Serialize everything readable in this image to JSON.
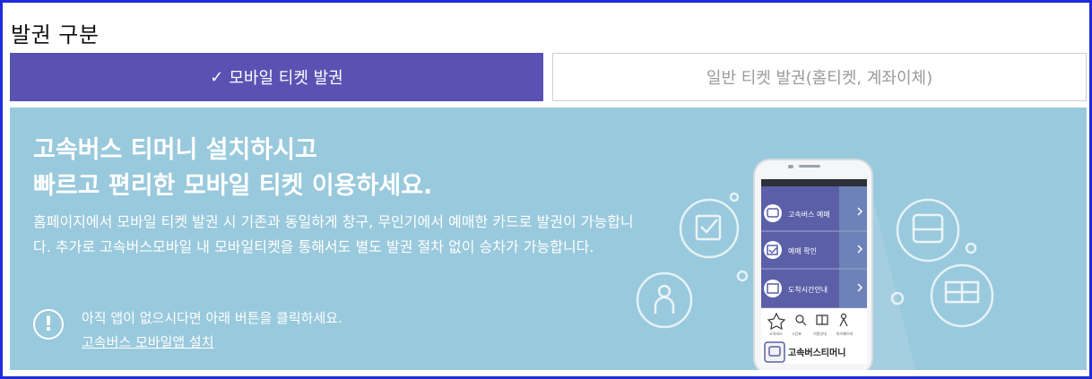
{
  "section": {
    "title": "발권 구분"
  },
  "tabs": [
    {
      "label": "모바일 티켓 발권",
      "check": "✓",
      "active": true
    },
    {
      "label": "일반 티켓 발권(홈티켓, 계좌이체)",
      "active": false
    }
  ],
  "banner": {
    "headline_line1": "고속버스 티머니 설치하시고",
    "headline_line2": "빠르고 편리한 모바일 티켓 이용하세요.",
    "description": "홈페이지에서 모바일 티켓 발권 시 기존과 동일하게 창구, 무인기에서 예매한 카드로 발권이 가능합니다. 추가로 고속버스모바일 내 모바일티켓을 통해서도 별도 발권 절차 없이 승차가 가능합니다.",
    "notice_symbol": "!",
    "notice_text": "아직 앱이 없으시다면 아래 버튼을 클릭하세요.",
    "install_link": "고속버스 모바일앱 설치"
  },
  "phone": {
    "menu": [
      {
        "label": "고속버스 예매",
        "icon": "bus-icon"
      },
      {
        "label": "예매 확인",
        "icon": "check-icon"
      },
      {
        "label": "도착시간안내",
        "icon": "clock-icon"
      }
    ],
    "app_name": "고속버스티머니"
  },
  "colors": {
    "accent": "#5a52b3",
    "banner": "#99c9dc",
    "frame": "#1f2bd6"
  }
}
